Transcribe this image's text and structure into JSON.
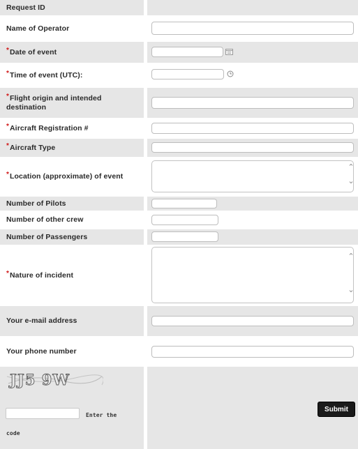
{
  "form": {
    "request_id_label": "Request ID",
    "operator_label": "Name of Operator",
    "date_label": "Date of event",
    "time_label": "Time of event (UTC):",
    "flight_label": "Flight origin and intended destination",
    "registration_label": "Aircraft Registration #",
    "type_label": "Aircraft Type",
    "location_label": "Location (approximate) of event",
    "pilots_label": "Number of Pilots",
    "crew_label": "Number of other crew",
    "passengers_label": "Number of Passengers",
    "nature_label": "Nature of incident",
    "email_label": "Your e-mail address",
    "phone_label": "Your phone number",
    "required_marker": "*"
  },
  "captcha": {
    "image_text": "JJ5 9W",
    "input_label_line1": "Enter the",
    "input_label_line2": "code"
  },
  "actions": {
    "submit_label": "Submit"
  },
  "colors": {
    "row_grey": "#e6e6e6",
    "required": "#d01818",
    "button": "#1a1a1a"
  },
  "icons": [
    "calendar-icon",
    "clock-icon",
    "scroll-up-icon",
    "scroll-down-icon"
  ]
}
